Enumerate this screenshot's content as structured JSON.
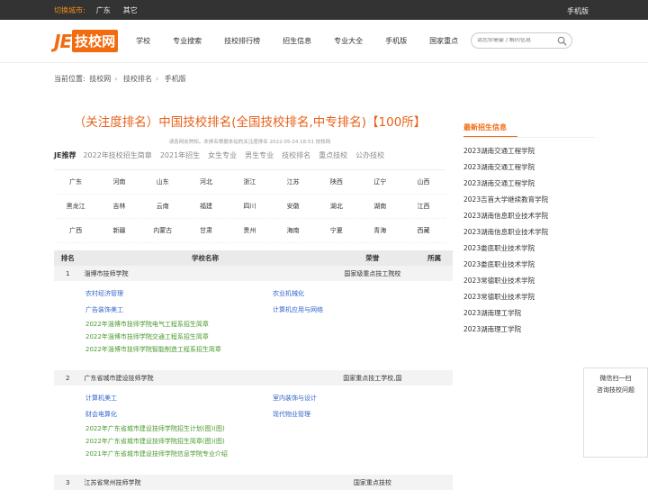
{
  "topbar": {
    "city_label": "切换城市:",
    "cities": [
      "广东",
      "其它"
    ],
    "mobile": "手机版"
  },
  "logo": {
    "je": "JE",
    "text": "技校网"
  },
  "nav": [
    "学校",
    "专业搜索",
    "技校排行榜",
    "招生信息",
    "专业大全",
    "手机版",
    "国家重点"
  ],
  "search": {
    "placeholder": "请您你需要了解的信息"
  },
  "breadcrumb": [
    "当前位置:",
    "技校网",
    "技校排名",
    "手机版"
  ],
  "article": {
    "title": "（关注度排名）中国技校排名(全国技校排名,中专排名)【100所】",
    "meta": "请各网友熟知。本排名根据本站的关注度排名 2022-05-24 18:51 技校网",
    "tag_lead": "JE推荐",
    "tags": [
      "2022年技校招生简章",
      "2021年招生",
      "女生专业",
      "男生专业",
      "技校排名",
      "重点技校",
      "公办技校"
    ]
  },
  "provinces": [
    [
      "广东",
      "河南",
      "山东",
      "河北",
      "浙江",
      "江苏",
      "陕西",
      "辽宁",
      "山西"
    ],
    [
      "黑龙江",
      "吉林",
      "云南",
      "福建",
      "四川",
      "安徽",
      "湖北",
      "湖南",
      "江西"
    ],
    [
      "广西",
      "新疆",
      "内蒙古",
      "甘肃",
      "贵州",
      "海南",
      "宁夏",
      "青海",
      "西藏"
    ]
  ],
  "table": {
    "headers": [
      "排名",
      "学校名称",
      "荣誉",
      "所属"
    ],
    "rows": [
      {
        "rank": "1",
        "name": "淄博市技师学院",
        "honor": "国家级重点技工院校",
        "belong": "",
        "majors": [
          "农村经济管理",
          "农业机械化",
          "广告装饰美工",
          "计算机应用与网络"
        ],
        "news": [
          "2022年淄博市技师学院电气工程系招生简章",
          "2022年淄博市技师学院交通工程系招生简章",
          "2022年淄博市技师学院智能制造工程系招生简章"
        ]
      },
      {
        "rank": "2",
        "name": "广东省城市建设技师学院",
        "honor": "国家重点技工学校,国",
        "belong": "",
        "majors": [
          "计算机美工",
          "室内装饰与设计",
          "财会电算化",
          "现代物业管理"
        ],
        "news": [
          "2022年广东省城市建设技师学院招生计划(图)(图)",
          "2022年广东省城市建设技师学院招生简章(图)(图)",
          "2021年广东省城市建设技师学院信息学院专业介绍"
        ]
      },
      {
        "rank": "3",
        "name": "江苏省常州技师学院",
        "honor": "国家重点技校",
        "belong": ""
      }
    ]
  },
  "sidebar": {
    "title": "最新招生信息",
    "items": [
      "2023湖南交通工程学院",
      "2023湖南交通工程学院",
      "2023湖南交通工程学院",
      "2023吉首大学继续教育学院",
      "2023湖南信息职业技术学院",
      "2023湖南信息职业技术学院",
      "2023娄底职业技术学院",
      "2023娄底职业技术学院",
      "2023常德职业技术学院",
      "2023常德职业技术学院",
      "2023湖南理工学院",
      "2023湖南理工学院"
    ]
  },
  "wechat": {
    "line1": "微信扫一扫",
    "line2": "咨询技校问题"
  },
  "colors": {
    "accent": "#f26b0f",
    "link": "#3366cc",
    "green_link": "#4a9a2c",
    "topbar": "#333333"
  }
}
